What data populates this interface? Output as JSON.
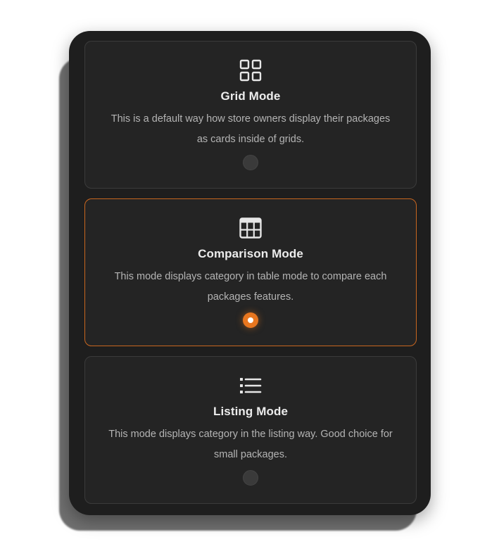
{
  "modes": [
    {
      "title": "Grid Mode",
      "description": "This is a default way how store owners display their packages as cards inside of grids.",
      "icon": "grid-icon",
      "selected": false
    },
    {
      "title": "Comparison Mode",
      "description": "This mode displays category in table mode to compare each packages features.",
      "icon": "table-icon",
      "selected": true
    },
    {
      "title": "Listing Mode",
      "description": "This mode displays category in the listing way. Good choice for small packages.",
      "icon": "list-icon",
      "selected": false
    }
  ],
  "colors": {
    "accent": "#e8761f",
    "panel": "#1e1e1e",
    "card": "#242424",
    "text": "#ececec",
    "muted": "#b4b4b4"
  }
}
